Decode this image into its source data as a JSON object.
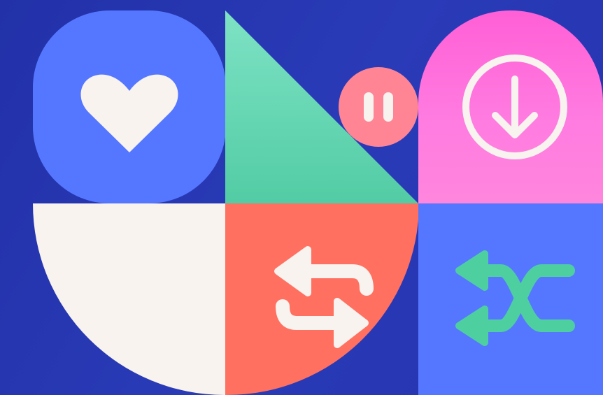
{
  "colors": {
    "background": "#2434b0",
    "heart_tile": "#5577ff",
    "triangle": "#5ad2a8",
    "pause_circle": "#ff8595",
    "download_tile": "#ff6fdc",
    "cream_tile": "#f8f3ef",
    "repeat_tile": "#ff7060",
    "shuffle_tile": "#5577ff",
    "icon_light": "#f8f3ef",
    "icon_green": "#4ecfa0"
  },
  "icons": {
    "heart": "heart-icon",
    "pause": "pause-icon",
    "download": "download-icon",
    "repeat": "repeat-icon",
    "shuffle": "shuffle-icon"
  }
}
